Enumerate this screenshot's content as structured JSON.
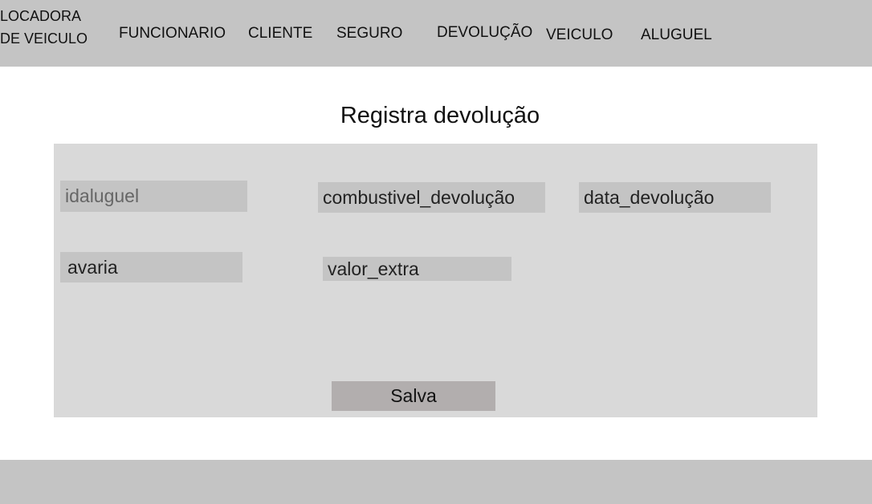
{
  "header": {
    "logo_text": "LOCADORA DE VEICULO",
    "nav": {
      "funcionario": "FUNCIONARIO",
      "cliente": "CLIENTE",
      "seguro": "SEGURO",
      "devolucao": "DEVOLUÇÃO",
      "veiculo": "VEICULO",
      "aluguel": "ALUGUEL"
    }
  },
  "main": {
    "title": "Registra devolução",
    "form": {
      "idaluguel": "idaluguel",
      "combustivel_devolucao": "combustivel_devolução",
      "data_devolucao": "data_devolução",
      "avaria": "avaria",
      "valor_extra": "valor_extra",
      "save_label": "Salva"
    }
  },
  "colors": {
    "header_bg": "#c4c4c4",
    "panel_bg": "#d9d9d9",
    "field_bg": "#c4c4c4",
    "button_bg": "#b2aeae"
  }
}
